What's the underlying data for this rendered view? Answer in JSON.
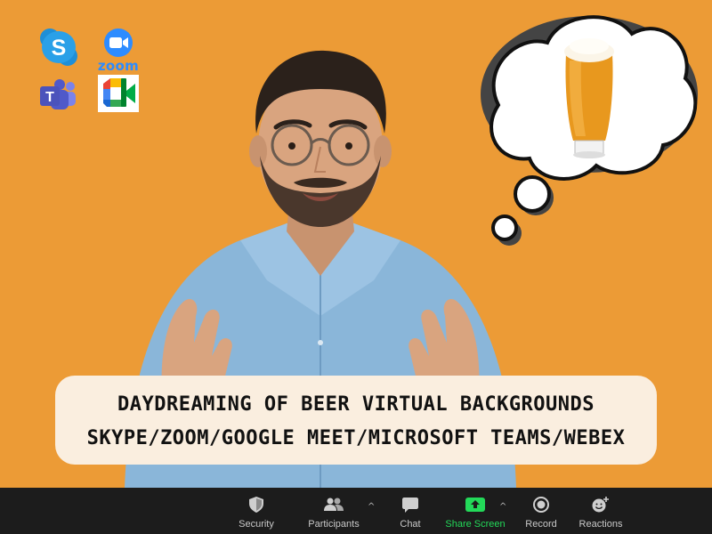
{
  "caption": {
    "line1": "DAYDREAMING OF BEER VIRTUAL BACKGROUNDS",
    "line2": "SKYPE/ZOOM/GOOGLE MEET/MICROSOFT TEAMS/WEBEX"
  },
  "logos": {
    "skype_letter": "S",
    "zoom_text": "zoom",
    "teams_letter": "T"
  },
  "toolbar": {
    "items": [
      {
        "label": "Security",
        "icon": "shield-icon"
      },
      {
        "label": "Participants",
        "icon": "people-icon"
      },
      {
        "label": "Chat",
        "icon": "chat-bubble-icon"
      },
      {
        "label": "Share Screen",
        "icon": "share-screen-icon"
      },
      {
        "label": "Record",
        "icon": "record-icon"
      },
      {
        "label": "Reactions",
        "icon": "emoji-plus-icon"
      }
    ],
    "caret": "^",
    "share_color": "#23D959"
  },
  "colors": {
    "background": "#EC9B36",
    "toolbar_bg": "#1C1C1C",
    "caption_bg": "#FAEEDF"
  }
}
